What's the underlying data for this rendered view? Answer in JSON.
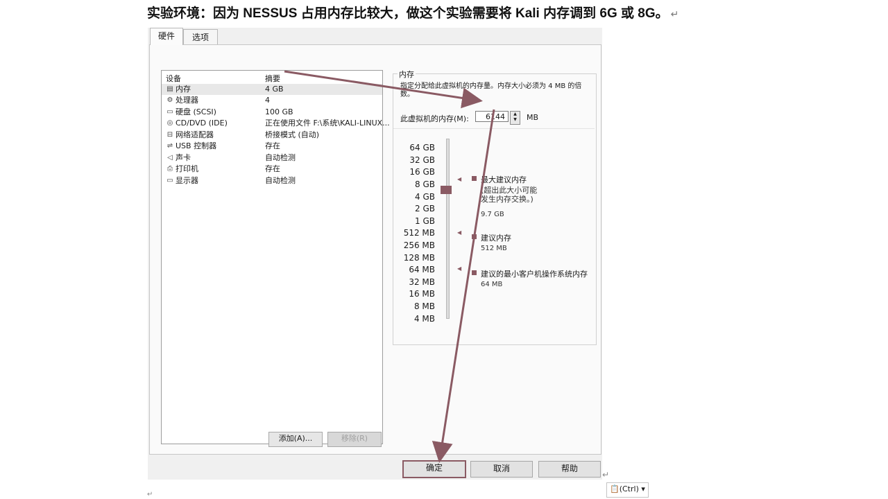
{
  "heading": "实验环境：因为 NESSUS 占用内存比较大，做这个实验需要将 Kali 内存调到 6G 或 8G。",
  "tabs": [
    "硬件",
    "选项"
  ],
  "devices": {
    "col_device": "设备",
    "col_summary": "摘要",
    "rows": [
      {
        "name": "内存",
        "summary": "4 GB",
        "icon": "memory-icon"
      },
      {
        "name": "处理器",
        "summary": "4",
        "icon": "cpu-icon"
      },
      {
        "name": "硬盘 (SCSI)",
        "summary": "100 GB",
        "icon": "disk-icon"
      },
      {
        "name": "CD/DVD (IDE)",
        "summary": "正在使用文件 F:\\系统\\KALI-LINUX...",
        "icon": "cd-icon"
      },
      {
        "name": "网络适配器",
        "summary": "桥接模式 (自动)",
        "icon": "network-icon"
      },
      {
        "name": "USB 控制器",
        "summary": "存在",
        "icon": "usb-icon"
      },
      {
        "name": "声卡",
        "summary": "自动检测",
        "icon": "sound-icon"
      },
      {
        "name": "打印机",
        "summary": "存在",
        "icon": "printer-icon"
      },
      {
        "name": "显示器",
        "summary": "自动检测",
        "icon": "monitor-icon"
      }
    ],
    "add_button": "添加(A)...",
    "remove_button": "移除(R)"
  },
  "memory": {
    "group_title": "内存",
    "description": "指定分配给此虚拟机的内存量。内存大小必须为 4 MB 的倍数。",
    "label": "此虚拟机的内存(M):",
    "value": "6144",
    "unit": "MB",
    "scale": [
      "64 GB",
      "32 GB",
      "16 GB",
      "8 GB",
      "4 GB",
      "2 GB",
      "1 GB",
      "512 MB",
      "256 MB",
      "128 MB",
      "64 MB",
      "32 MB",
      "16 MB",
      "8 MB",
      "4 MB"
    ],
    "max_recommended_label": "最大建议内存",
    "max_recommended_note": "(超出此大小可能发生内存交换。)",
    "max_recommended_value": "9.7 GB",
    "recommended_label": "建议内存",
    "recommended_value": "512 MB",
    "min_guest_label": "建议的最小客户机操作系统内存",
    "min_guest_value": "64 MB"
  },
  "footer": {
    "ok": "确定",
    "cancel": "取消",
    "help": "帮助"
  },
  "ctrl_badge": "(Ctrl)",
  "colors": {
    "accent": "#8a5a63",
    "dialog_bg": "#f0f0f0"
  }
}
